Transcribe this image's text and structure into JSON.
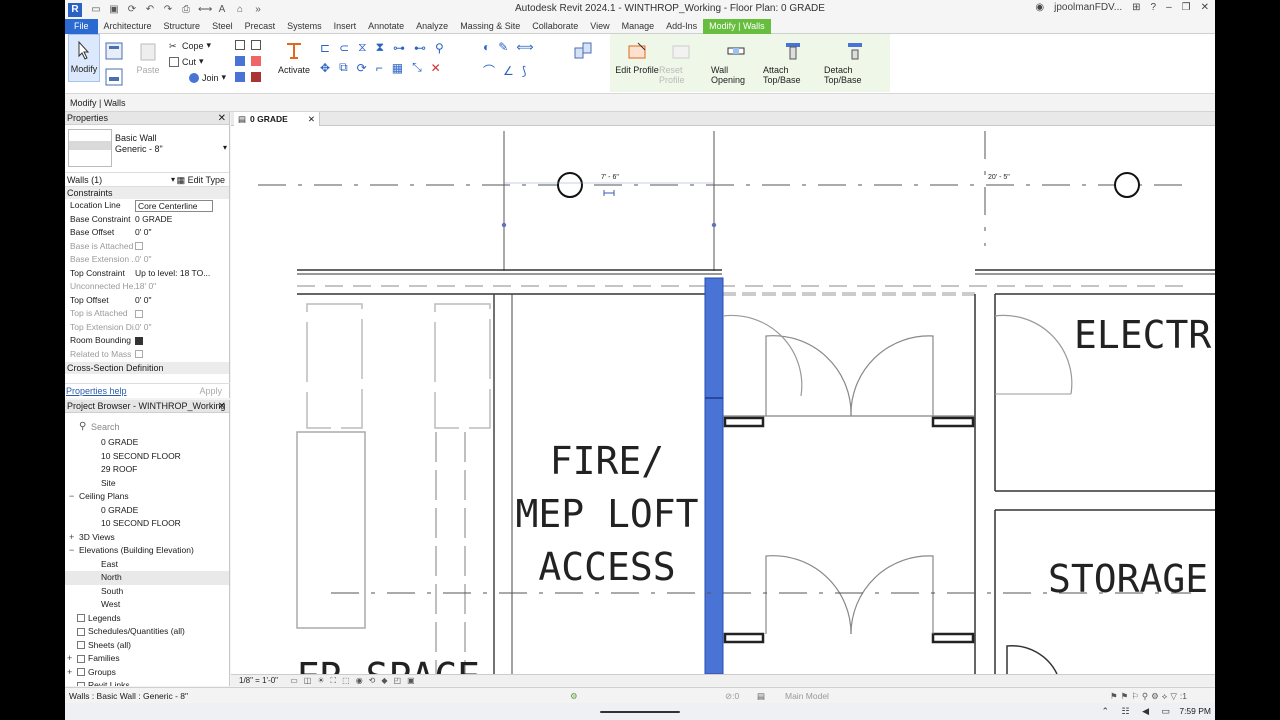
{
  "app": {
    "window_title": "Autodesk Revit 2024.1 - WINTHROP_Working - Floor Plan: 0 GRADE",
    "user": "jpoolmanFDV...",
    "logo": "R"
  },
  "ribbon_tabs": [
    "File",
    "Architecture",
    "Structure",
    "Steel",
    "Precast",
    "Systems",
    "Insert",
    "Annotate",
    "Analyze",
    "Massing & Site",
    "Collaborate",
    "View",
    "Manage",
    "Add-Ins",
    "Modify | Walls"
  ],
  "ribbon": {
    "modify": "Modify",
    "cope": "Cope",
    "cut": "Cut",
    "join": "Join",
    "paste": "Paste",
    "activate": "Activate",
    "edit_profile": "Edit Profile",
    "reset_profile": "Reset Profile",
    "wall_opening": "Wall Opening",
    "attach_top_base": "Attach Top/Base",
    "detach_top_base": "Detach Top/Base"
  },
  "options_bar": "Modify | Walls",
  "properties": {
    "title": "Properties",
    "type_family": "Basic Wall",
    "type_name": "Generic - 8\"",
    "filter": "Walls (1)",
    "edit_type": "Edit Type",
    "section_constraints": "Constraints",
    "rows": [
      {
        "k": "Location Line",
        "v": "Core Centerline"
      },
      {
        "k": "Base Constraint",
        "v": "0 GRADE"
      },
      {
        "k": "Base Offset",
        "v": "0'  0\""
      },
      {
        "k": "Base is Attached",
        "v": ""
      },
      {
        "k": "Base Extension ...",
        "v": "0'  0\""
      },
      {
        "k": "Top Constraint",
        "v": "Up to level: 18 TO..."
      },
      {
        "k": "Unconnected He...",
        "v": "18'  0\""
      },
      {
        "k": "Top Offset",
        "v": "0'  0\""
      },
      {
        "k": "Top is Attached",
        "v": ""
      },
      {
        "k": "Top Extension Di...",
        "v": "0'  0\""
      },
      {
        "k": "Room Bounding",
        "v": ""
      },
      {
        "k": "Related to Mass",
        "v": ""
      }
    ],
    "section_cross": "Cross-Section Definition",
    "help": "Properties help",
    "apply": "Apply"
  },
  "browser": {
    "title": "Project Browser - WINTHROP_Working",
    "search_placeholder": "Search",
    "items": [
      "0 GRADE",
      "10 SECOND FLOOR",
      "29 ROOF",
      "Site",
      "Ceiling Plans",
      "0 GRADE",
      "10 SECOND FLOOR",
      "3D Views",
      "Elevations (Building Elevation)",
      "East",
      "North",
      "South",
      "West",
      "Legends",
      "Schedules/Quantities (all)",
      "Sheets (all)",
      "Families",
      "Groups",
      "Revit Links"
    ]
  },
  "view": {
    "tab": "0 GRADE",
    "scale": "1/8\" = 1'-0\"",
    "dim_left": "7' - 6\"",
    "dim_right": "20' - 5\"",
    "room_fire_1": "FIRE/",
    "room_fire_2": "MEP LOFT",
    "room_fire_3": "ACCESS",
    "room_electric": "ELECTRIC",
    "room_storage": "STORAGE",
    "room_partial": "ER SPACE"
  },
  "status": {
    "selection": "Walls : Basic Wall : Generic - 8\"",
    "worksharing": ":0",
    "model": "Main Model",
    "filter_count": ":1"
  },
  "taskbar": {
    "clock": "7:59 PM"
  },
  "colors": {
    "selected_wall": "#4a73d6",
    "context_tab": "#67bd3e",
    "file_tab": "#2a6ad1"
  }
}
